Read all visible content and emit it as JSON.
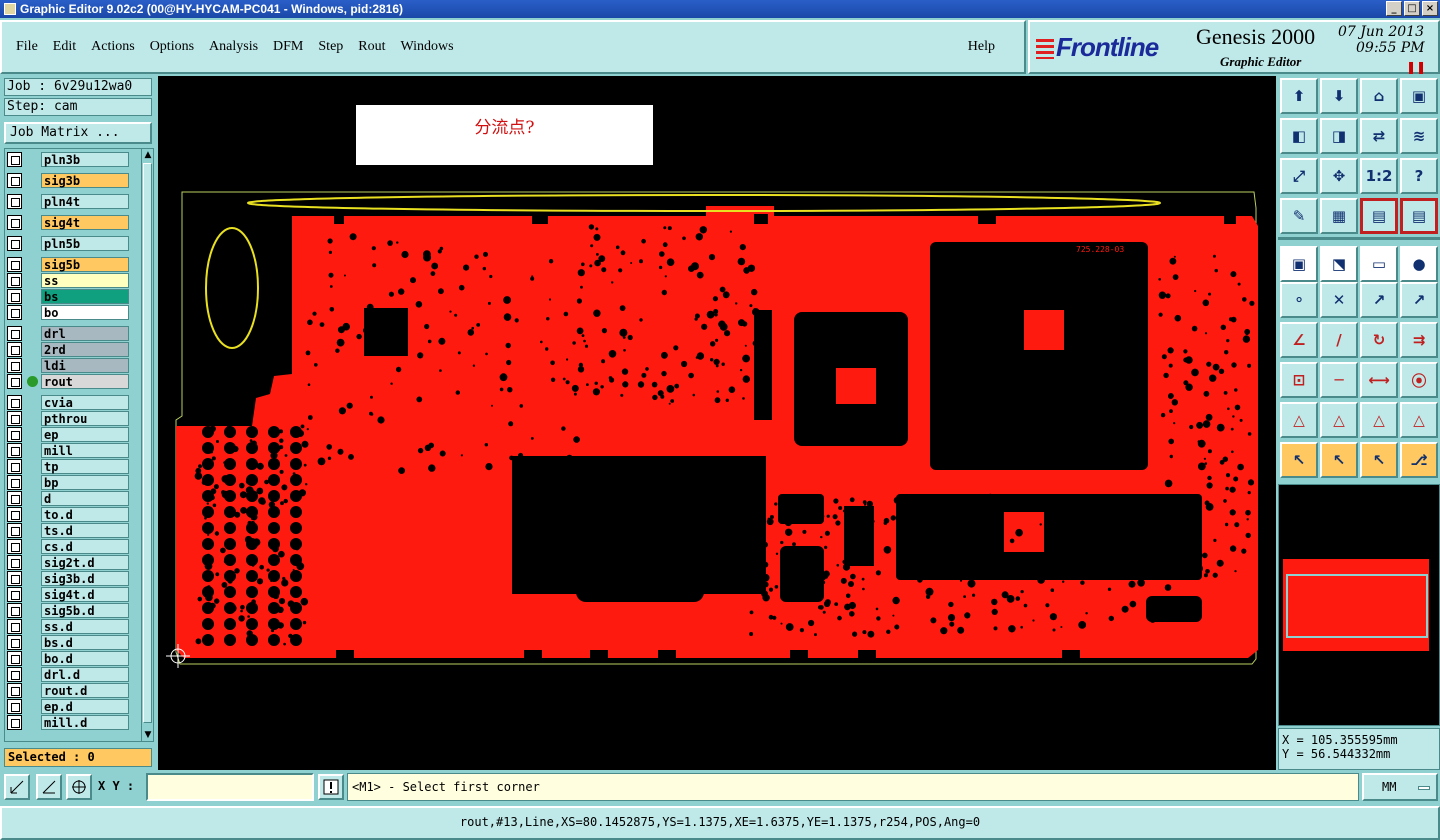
{
  "window": {
    "title": "Graphic Editor 9.02c2 (00@HY-HYCAM-PC041 - Windows, pid:2816)",
    "buttons": [
      "_",
      "□",
      "×"
    ]
  },
  "menu": {
    "items": [
      "File",
      "Edit",
      "Actions",
      "Options",
      "Analysis",
      "DFM",
      "Step",
      "Rout",
      "Windows"
    ],
    "help": "Help"
  },
  "brand": {
    "logo": "Frontline",
    "product": "Genesis 2000",
    "subtitle": "Graphic Editor",
    "date": "07 Jun 2013",
    "time": "09:55 PM"
  },
  "job": {
    "job_label": "Job : 6v29u12wa0",
    "step_label": "Step: cam",
    "matrix_button": "Job Matrix ..."
  },
  "layers": [
    {
      "name": "pln3b",
      "color": "#bfe8e8"
    },
    {
      "name": "sig3b",
      "color": "#ffc860"
    },
    {
      "name": "pln4t",
      "color": "#bfe8e8"
    },
    {
      "name": "sig4t",
      "color": "#ffc860"
    },
    {
      "name": "pln5b",
      "color": "#bfe8e8"
    },
    {
      "name": "sig5b",
      "color": "#ffc860"
    },
    {
      "name": "ss",
      "color": "#ffffc0"
    },
    {
      "name": "bs",
      "color": "#10a080"
    },
    {
      "name": "bo",
      "color": "#ffffff"
    },
    {
      "name": "drl",
      "color": "#a8b8c0"
    },
    {
      "name": "2rd",
      "color": "#a8b8c0"
    },
    {
      "name": "ldi",
      "color": "#a8b8c0"
    },
    {
      "name": "rout",
      "color": "#d8d8d8",
      "active": true
    },
    {
      "name": "cvia",
      "color": "#bfe8e8"
    },
    {
      "name": "pthrou",
      "color": "#bfe8e8"
    },
    {
      "name": "ep",
      "color": "#bfe8e8"
    },
    {
      "name": "mill",
      "color": "#bfe8e8"
    },
    {
      "name": "tp",
      "color": "#bfe8e8"
    },
    {
      "name": "bp",
      "color": "#bfe8e8"
    },
    {
      "name": "d",
      "color": "#bfe8e8"
    },
    {
      "name": "to.d",
      "color": "#bfe8e8"
    },
    {
      "name": "ts.d",
      "color": "#bfe8e8"
    },
    {
      "name": "cs.d",
      "color": "#bfe8e8"
    },
    {
      "name": "sig2t.d",
      "color": "#bfe8e8"
    },
    {
      "name": "sig3b.d",
      "color": "#bfe8e8"
    },
    {
      "name": "sig4t.d",
      "color": "#bfe8e8"
    },
    {
      "name": "sig5b.d",
      "color": "#bfe8e8"
    },
    {
      "name": "ss.d",
      "color": "#bfe8e8"
    },
    {
      "name": "bs.d",
      "color": "#bfe8e8"
    },
    {
      "name": "bo.d",
      "color": "#bfe8e8"
    },
    {
      "name": "drl.d",
      "color": "#bfe8e8"
    },
    {
      "name": "rout.d",
      "color": "#bfe8e8"
    },
    {
      "name": "ep.d",
      "color": "#bfe8e8"
    },
    {
      "name": "mill.d",
      "color": "#bfe8e8"
    }
  ],
  "selected_label": "Selected : 0",
  "canvas": {
    "note": "分流点?",
    "board_label": "725.228-03",
    "board_color": "#ff1a10",
    "outline_color": "#d0e060"
  },
  "toolbar_icons": [
    "open-step-icon",
    "save-icon",
    "home-icon",
    "window-split-icon",
    "pan-left-icon",
    "pan-right-icon",
    "swap-icon",
    "snake-icon",
    "fit-icon",
    "center-icon",
    "scale-icon",
    "help-icon",
    "pen-icon",
    "grid-icon",
    "layer-red-icon",
    "layer-red2-icon",
    "pad-icon",
    "line-icon",
    "ruler-icon",
    "select-dot-icon",
    "net-icon",
    "cross-icon",
    "connect-icon",
    "connect2-icon",
    "angle-icon",
    "slash-icon",
    "arc-icon",
    "ff-icon",
    "pad-move-icon",
    "minus-icon",
    "measure-icon",
    "drill-icon",
    "triangle-icon",
    "triangle2-icon",
    "triangle3-icon",
    "triangle4-icon",
    "pointer-icon",
    "pointer-box-icon",
    "pointer-box2-icon",
    "route-icon"
  ],
  "coords": {
    "x": "X = 105.355595mm",
    "y": "Y =  56.544332mm"
  },
  "bottom": {
    "xy_label": "X Y :",
    "xy_value": "",
    "prompt": "<M1> - Select first corner",
    "units": "MM"
  },
  "status": "rout,#13,Line,XS=80.1452875,YS=1.1375,XE=1.6375,YE=1.1375,r254,POS,Ang=0"
}
